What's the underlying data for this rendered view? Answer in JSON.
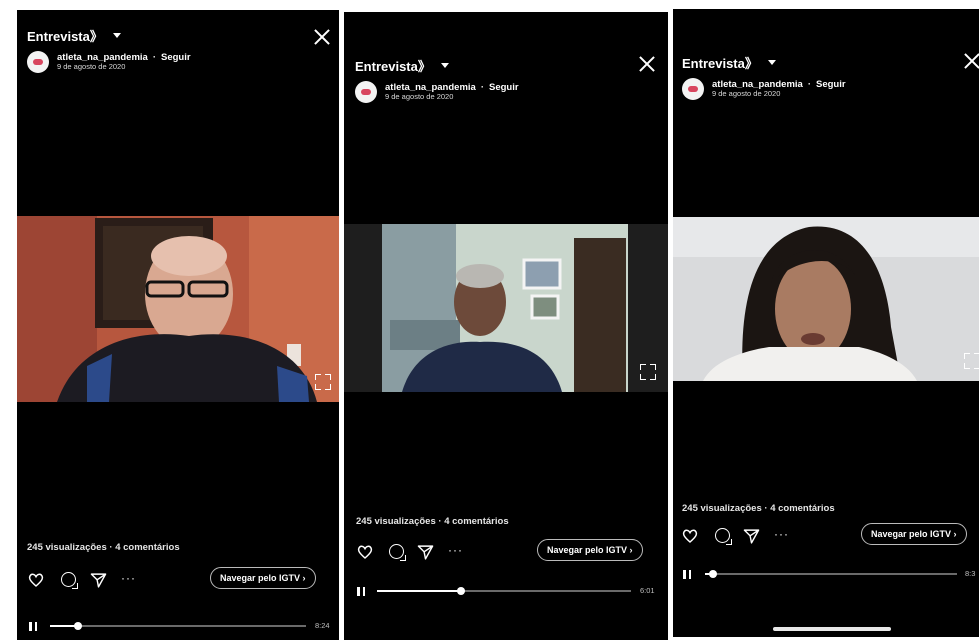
{
  "colors": {
    "background": "#000000",
    "accent_avatar": "#d8465f",
    "button_border": "#bbbbbb"
  },
  "screens": [
    {
      "title": "Entrevista》",
      "username": "atleta_na_pandemia",
      "follow": "Seguir",
      "date": "9 de agosto de 2020",
      "views": "245 visualizações · 4 comentários",
      "nav_button": "Navegar pelo IGTV ›",
      "time": "8:24",
      "more": "···",
      "progress": 0.11
    },
    {
      "title": "Entrevista》",
      "username": "atleta_na_pandemia",
      "follow": "Seguir",
      "date": "9 de agosto de 2020",
      "views": "245 visualizações · 4 comentários",
      "nav_button": "Navegar pelo IGTV ›",
      "time": "6:01",
      "more": "···",
      "progress": 0.33
    },
    {
      "title": "Entrevista》",
      "username": "atleta_na_pandemia",
      "follow": "Seguir",
      "date": "9 de agosto de 2020",
      "views": "245 visualizações · 4 comentários",
      "nav_button": "Navegar pelo IGTV ›",
      "time": "8:3",
      "more": "···",
      "progress": 0.03
    }
  ],
  "icons": [
    "chevron-down-icon",
    "close-icon",
    "heart-icon",
    "comment-icon",
    "send-icon",
    "more-icon",
    "fullscreen-icon",
    "pause-icon"
  ]
}
